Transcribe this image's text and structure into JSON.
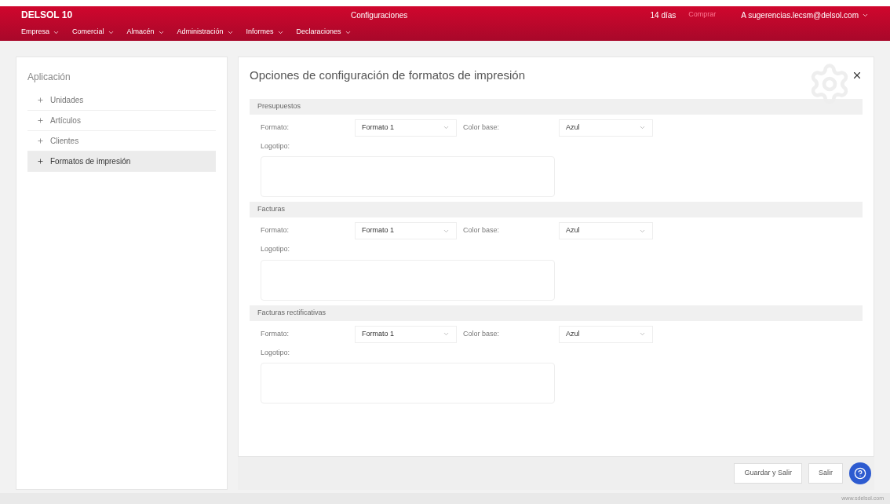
{
  "header": {
    "logo": "DELSOL 10",
    "title": "Configuraciones",
    "trial": "14 días",
    "trial_button": "Comprar",
    "user": "A sugerencias.lecsm@delsol.com"
  },
  "menu": [
    {
      "label": "Empresa"
    },
    {
      "label": "Comercial"
    },
    {
      "label": "Almacén"
    },
    {
      "label": "Administración"
    },
    {
      "label": "Informes"
    },
    {
      "label": "Declaraciones"
    }
  ],
  "sidebar": {
    "title": "Aplicación",
    "items": [
      {
        "label": "Unidades",
        "selected": false
      },
      {
        "label": "Artículos",
        "selected": false
      },
      {
        "label": "Clientes",
        "selected": false
      },
      {
        "label": "Formatos de impresión",
        "selected": true
      }
    ]
  },
  "panel": {
    "title": "Opciones de configuración de formatos de impresión",
    "sections": [
      {
        "title": "Presupuestos",
        "format_label": "Formato:",
        "format_value": "Formato 1",
        "color_label": "Color base:",
        "color_value": "Azul",
        "logo_label": "Logotipo:"
      },
      {
        "title": "Facturas",
        "format_label": "Formato:",
        "format_value": "Formato 1",
        "color_label": "Color base:",
        "color_value": "Azul",
        "logo_label": "Logotipo:"
      },
      {
        "title": "Facturas rectificativas",
        "format_label": "Formato:",
        "format_value": "Formato 1",
        "color_label": "Color base:",
        "color_value": "Azul",
        "logo_label": "Logotipo:"
      }
    ]
  },
  "buttons": [
    "Guardar y Salir",
    "Salir"
  ],
  "footer": "www.sdelsol.com"
}
